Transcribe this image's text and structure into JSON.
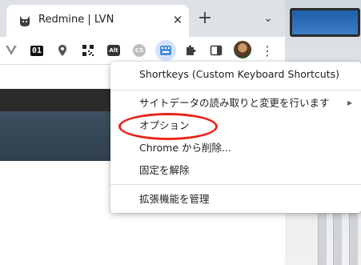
{
  "tab": {
    "title": "Redmine | LVN",
    "close_glyph": "✕"
  },
  "tabstrip": {
    "new_tab_glyph": "+",
    "tab_search_glyph": "⌄"
  },
  "toolbar": {
    "ext_01_label": "01",
    "ext_alt_label": "Alt",
    "ext_cs_label": "CS",
    "menu_glyph": "⋮"
  },
  "context_menu": {
    "items": [
      {
        "label": "Shortkeys (Custom Keyboard Shortcuts)"
      },
      {
        "label": "サイトデータの読み取りと変更を行います",
        "submenu_arrow": "▶"
      },
      {
        "label": "オプション",
        "highlighted": true
      },
      {
        "label": "Chrome から削除..."
      },
      {
        "label": "固定を解除"
      },
      {
        "label": "拡張機能を管理"
      }
    ]
  },
  "colors": {
    "annotation": "#e8261b",
    "tabstrip_bg": "#dee1e6",
    "active_extension_bg": "#d3e3fd",
    "page_header": "#2f3f4e"
  }
}
